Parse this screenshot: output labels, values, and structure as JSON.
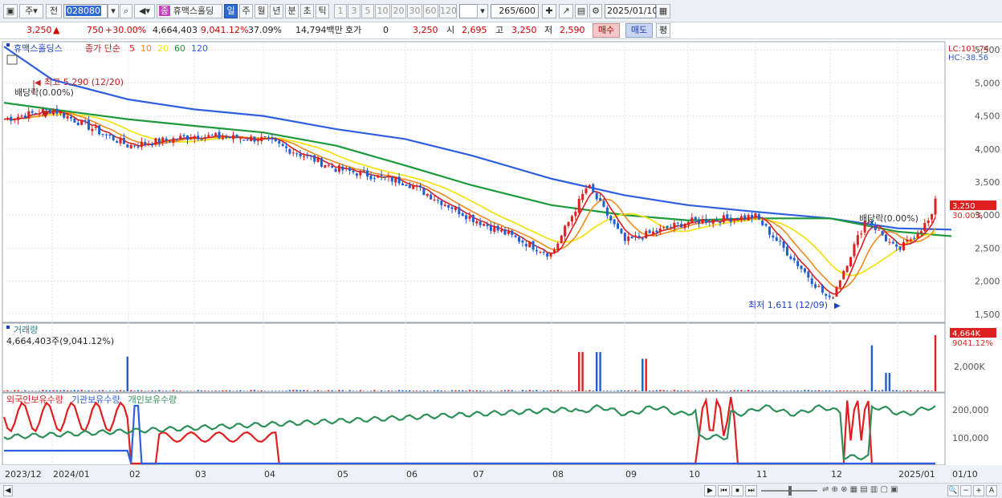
{
  "toolbar": {
    "period_label": "주",
    "prev_label": "전",
    "code_value": "028080",
    "stock_name": "휴맥스홀딩",
    "stock_badge": "종",
    "tabs": [
      "일",
      "주",
      "월",
      "년",
      "분",
      "초",
      "틱"
    ],
    "active_tab": "일",
    "intervals": [
      "1",
      "3",
      "5",
      "10",
      "20",
      "30",
      "60",
      "120"
    ],
    "count_value": "265",
    "count_total": "/600",
    "date_value": "2025/01/10"
  },
  "quote": {
    "price": "3,250",
    "change": "750",
    "change_pct": "+30.00%",
    "volume": "4,664,403",
    "volume_pct": "9,041.12%",
    "turnover_pct": "37.09%",
    "amount": "14,794백만",
    "hoga_label": "호가",
    "hoga_value": "0",
    "hoga_price": "3,250",
    "open_label": "시",
    "open": "2,695",
    "high_label": "고",
    "high": "3,250",
    "low_label": "저",
    "low": "2,590",
    "buy_label": "매수",
    "sell_label": "매도",
    "avg_label": "평"
  },
  "price_panel": {
    "legend_name": "휴맥스홀딩스",
    "legend_ma_label": "종가 단순",
    "ma_periods": [
      "5",
      "10",
      "20",
      "60",
      "120"
    ],
    "lc": "LC:101.74",
    "hc": "HC:-38.56",
    "current_price_tag": "3,250",
    "current_pct_tag": "30.00%",
    "high_annotation": "최고 5,290 (12/20)",
    "low_annotation": "최저 1,611 (12/09)",
    "dividend_left": "배당락(0.00%)",
    "dividend_right": "배당락(0.00%)"
  },
  "volume_panel": {
    "title": "거래량",
    "summary": "4,664,403주(9,041.12%)",
    "current_tag": "4,664K",
    "current_pct": "9041.12%"
  },
  "holding_panel": {
    "legend": [
      "외국인보유수량",
      "기관보유수량",
      "개인보유수량"
    ]
  },
  "colors": {
    "up": "#e02020",
    "down": "#1f5fd0",
    "ma5": "#d81f1f",
    "ma10": "#f08a1c",
    "ma20": "#f2e21a",
    "ma60": "#1c9a3a",
    "ma120": "#2f5fe0",
    "foreign": "#e02020",
    "institution": "#2f5fe0",
    "individual": "#2f8f5a"
  },
  "chart_data": [
    {
      "type": "candlestick",
      "title": "휴맥스홀딩스",
      "x_ticks": [
        "2023/12",
        "2024/01",
        "02",
        "03",
        "04",
        "05",
        "06",
        "07",
        "08",
        "09",
        "10",
        "11",
        "12",
        "2025/01",
        "01/10"
      ],
      "ylim": [
        1400,
        5600
      ],
      "y_ticks": [
        5500,
        5000,
        4500,
        4000,
        3500,
        3000,
        2500,
        2000,
        1500
      ],
      "y_tick_labels": [
        "5,500",
        "5,000",
        "4,500",
        "4,000",
        "3,500",
        "3,000",
        "2,500",
        "2,000",
        "1,500"
      ],
      "close_path": [
        [
          "2023/12",
          4450
        ],
        [
          "2024/01",
          4600
        ],
        [
          "02",
          4050
        ],
        [
          "03",
          4200
        ],
        [
          "04",
          4150
        ],
        [
          "05",
          3700
        ],
        [
          "06",
          3500
        ],
        [
          "07",
          2950
        ],
        [
          "08",
          2400
        ],
        [
          "08",
          3450
        ],
        [
          "09",
          2600
        ],
        [
          "10",
          2900
        ],
        [
          "11",
          2980
        ],
        [
          "12",
          1700
        ],
        [
          "12",
          2950
        ],
        [
          "2025/01",
          2450
        ],
        [
          "01/10",
          3250
        ]
      ],
      "ma120": [
        [
          "2023/12",
          5550
        ],
        [
          "2024/01",
          5050
        ],
        [
          "02",
          4750
        ],
        [
          "03",
          4600
        ],
        [
          "04",
          4500
        ],
        [
          "05",
          4300
        ],
        [
          "06",
          4150
        ],
        [
          "07",
          3900
        ],
        [
          "08",
          3550
        ],
        [
          "09",
          3300
        ],
        [
          "10",
          3150
        ],
        [
          "11",
          3050
        ],
        [
          "12",
          2950
        ],
        [
          "2025/01",
          2800
        ],
        [
          "01/10",
          2780
        ]
      ],
      "ma60": [
        [
          "2023/12",
          4700
        ],
        [
          "2024/01",
          4600
        ],
        [
          "02",
          4450
        ],
        [
          "03",
          4350
        ],
        [
          "04",
          4250
        ],
        [
          "05",
          4050
        ],
        [
          "06",
          3750
        ],
        [
          "07",
          3450
        ],
        [
          "08",
          3150
        ],
        [
          "09",
          3000
        ],
        [
          "10",
          2920
        ],
        [
          "11",
          2950
        ],
        [
          "12",
          2950
        ],
        [
          "2025/01",
          2750
        ],
        [
          "01/10",
          2680
        ]
      ],
      "high": {
        "value": 5290,
        "date": "12/20"
      },
      "low": {
        "value": 1611,
        "date": "12/09"
      },
      "last": 3250,
      "change_pct": 30.0
    },
    {
      "type": "bar",
      "title": "거래량",
      "y_ticks": [
        "2,000K"
      ],
      "last_value": 4664403,
      "last_pct": 9041.12
    },
    {
      "type": "line",
      "title": "보유수량",
      "series": [
        {
          "name": "외국인보유수량"
        },
        {
          "name": "기관보유수량"
        },
        {
          "name": "개인보유수량"
        }
      ],
      "y_ticks": [
        "200,000",
        "100,000"
      ]
    }
  ],
  "footer": {
    "nav_buttons": [
      "▶",
      "⏮",
      "⏹",
      "⏭"
    ],
    "zoom_buttons": [
      "🔍",
      "−",
      "+",
      "A"
    ]
  }
}
